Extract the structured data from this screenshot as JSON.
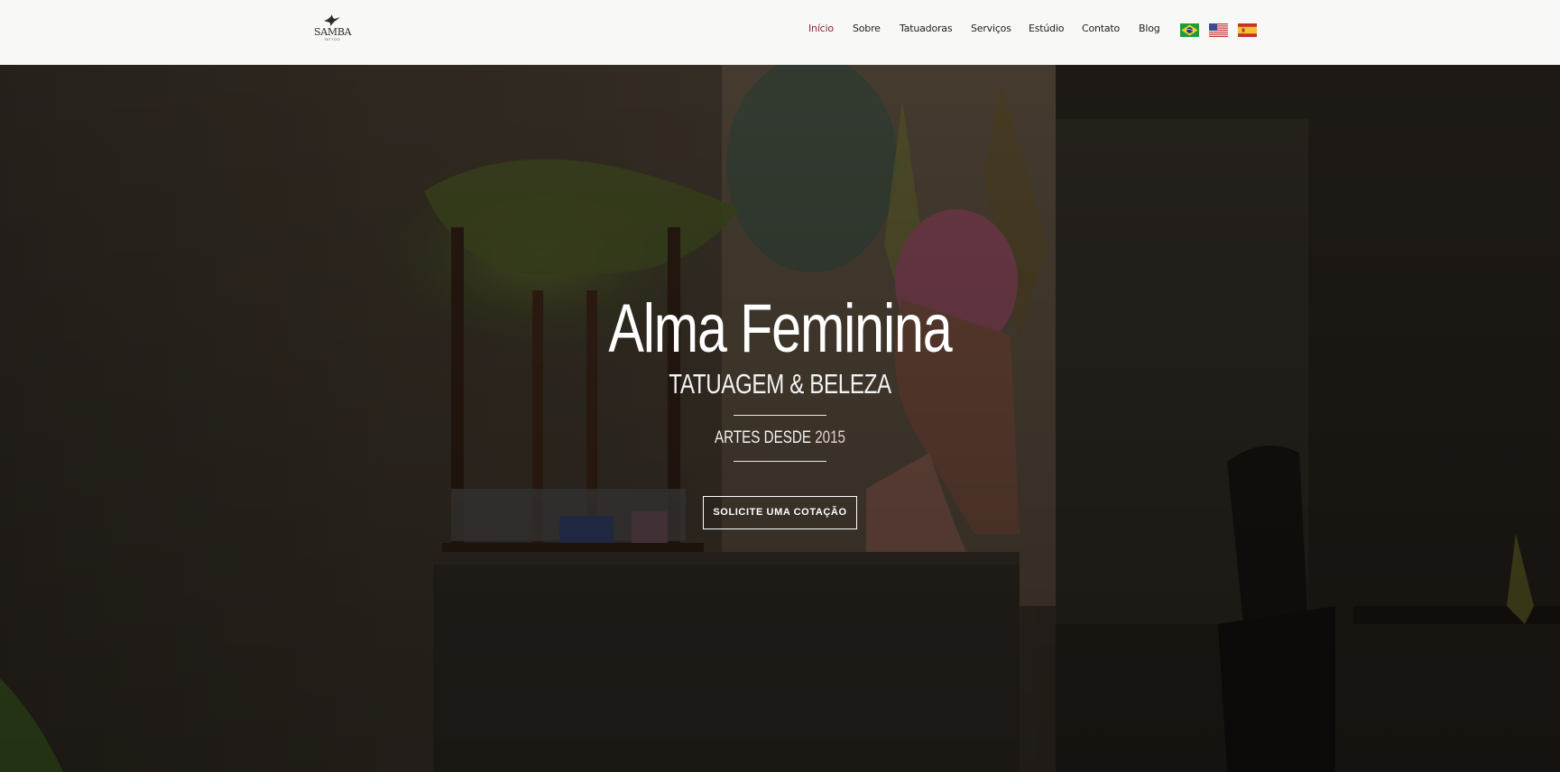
{
  "header": {
    "logo": {
      "name": "SAMBA",
      "sub": "TATTOO"
    },
    "nav": [
      {
        "label": "Início",
        "active": true
      },
      {
        "label": "Sobre",
        "active": false
      },
      {
        "label": "Tatuadoras",
        "active": false
      },
      {
        "label": "Serviços",
        "active": false
      },
      {
        "label": "Estúdio",
        "active": false
      },
      {
        "label": "Contato",
        "active": false
      },
      {
        "label": "Blog",
        "active": false
      }
    ],
    "languages": [
      {
        "icon": "brazil-flag-icon"
      },
      {
        "icon": "usa-flag-icon"
      },
      {
        "icon": "spain-flag-icon"
      }
    ],
    "active_color": "#8b2335"
  },
  "hero": {
    "title": "Alma Feminina",
    "subtitle": "TATUAGEM & BELEZA",
    "since_label": "ARTES DESDE",
    "since_year": "2015",
    "cta_label": "SOLICITE UMA COTAÇÃO"
  }
}
